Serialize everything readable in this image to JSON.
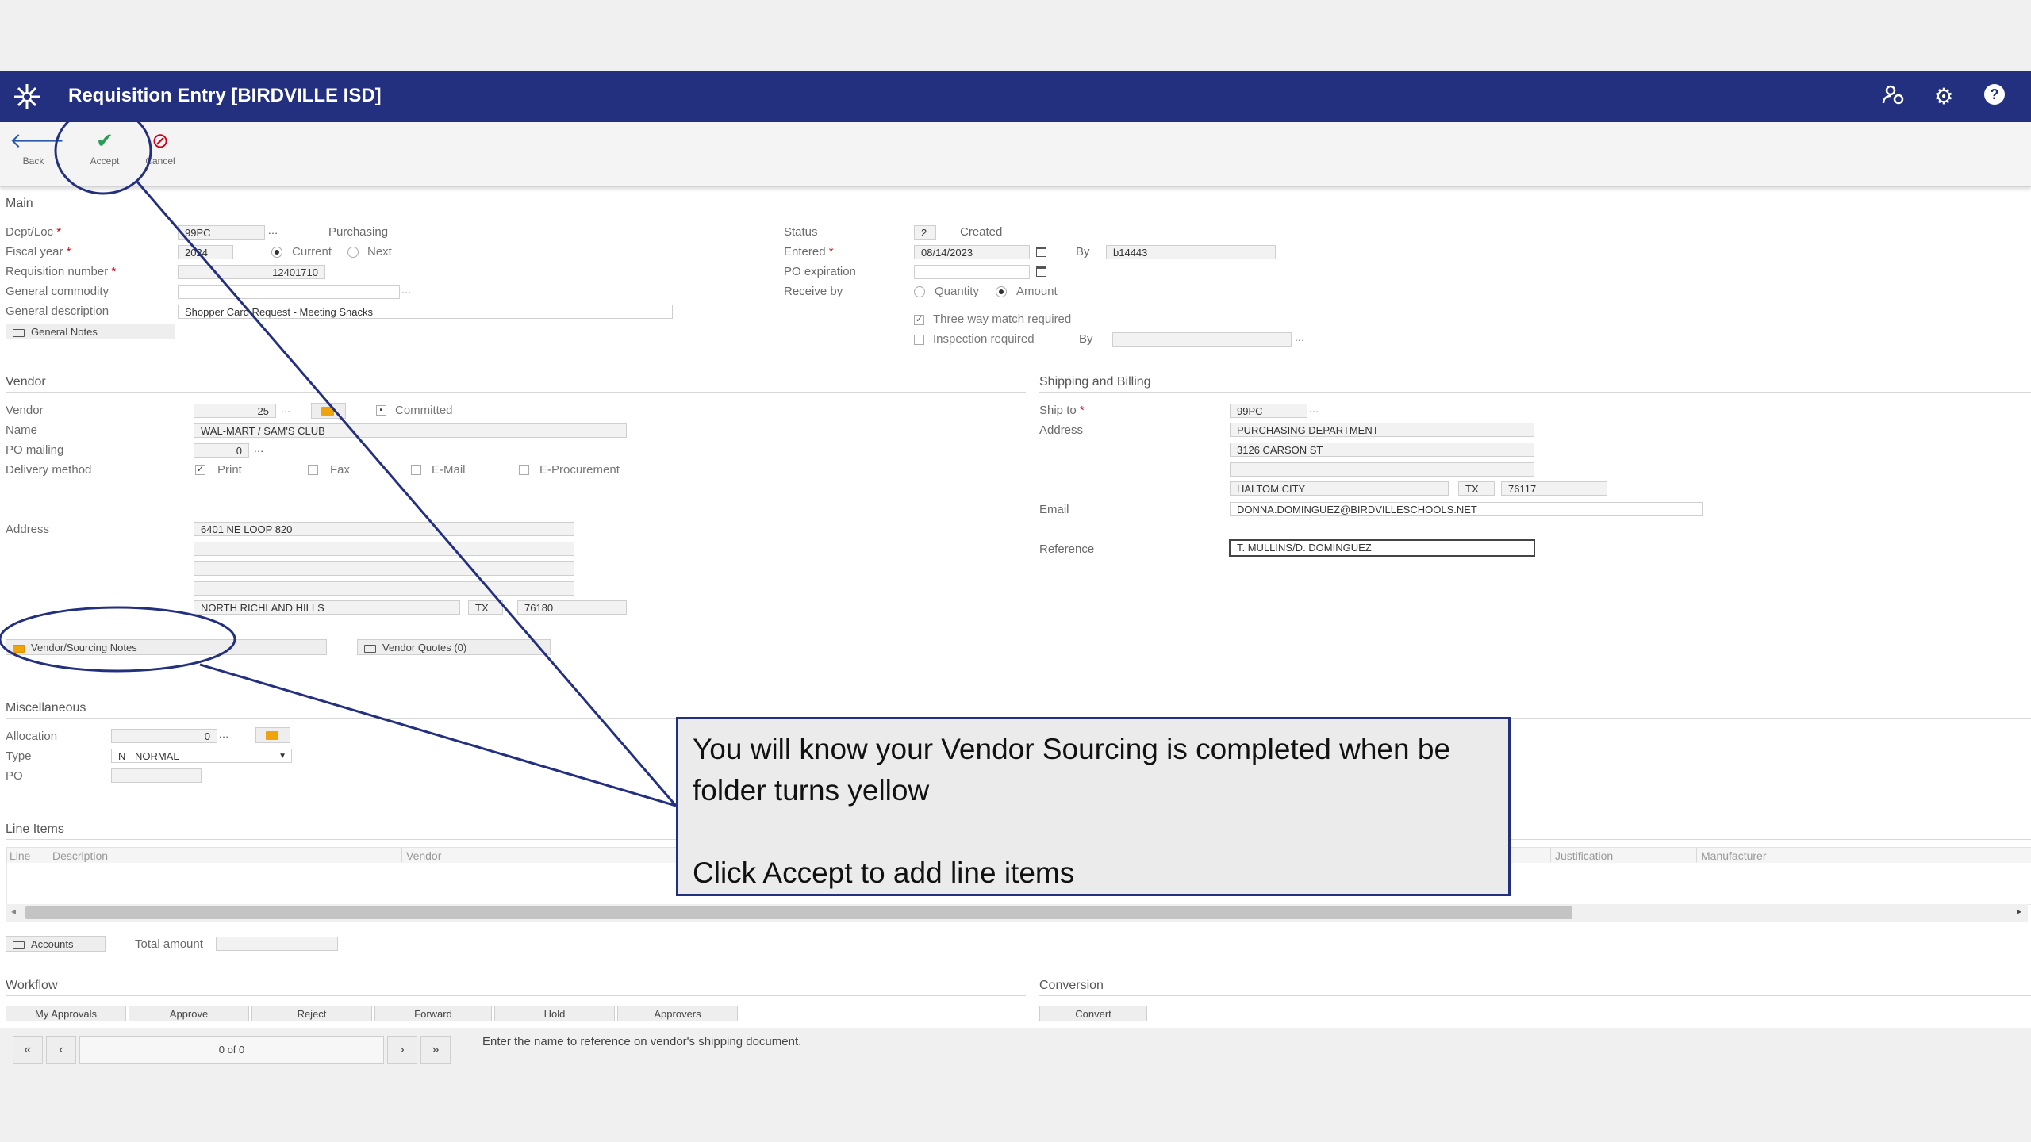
{
  "app": {
    "title": "Requisition Entry [BIRDVILLE ISD]",
    "accent": "#232f7f"
  },
  "toolbar": {
    "back_label": "Back",
    "accept_label": "Accept",
    "cancel_label": "Cancel"
  },
  "main": {
    "section": "Main",
    "dept_label": "Dept/Loc",
    "dept_value": "99PC",
    "dept_desc": "Purchasing",
    "fiscal_label": "Fiscal year",
    "fiscal_value": "2024",
    "fiscal_current": "Current",
    "fiscal_next": "Next",
    "reqnum_label": "Requisition number",
    "reqnum_value": "12401710",
    "commodity_label": "General commodity",
    "commodity_value": "",
    "desc_label": "General description",
    "desc_value": "Shopper Card Request - Meeting Snacks",
    "notes_button": "General Notes",
    "status_label": "Status",
    "status_value": "2",
    "status_text": "Created",
    "entered_label": "Entered",
    "entered_value": "08/14/2023",
    "by_label": "By",
    "by_value": "b14443",
    "expiration_label": "PO expiration",
    "receive_label": "Receive by",
    "receive_quantity": "Quantity",
    "receive_amount": "Amount",
    "threeway_label": "Three way match required",
    "inspection_label": "Inspection required",
    "inspection_by": "By"
  },
  "vendor": {
    "section": "Vendor",
    "vendor_label": "Vendor",
    "vendor_value": "25",
    "committed_label": "Committed",
    "name_label": "Name",
    "name_value": "WAL-MART / SAM'S CLUB",
    "mailing_label": "PO mailing",
    "mailing_value": "0",
    "delivery_label": "Delivery method",
    "delivery_print": "Print",
    "delivery_fax": "Fax",
    "delivery_email": "E-Mail",
    "delivery_eproc": "E-Procurement",
    "address_label": "Address",
    "address_line1": "6401 NE LOOP 820",
    "city": "NORTH RICHLAND HILLS",
    "state": "TX",
    "zip": "76180",
    "sourcing_notes": "Vendor/Sourcing Notes",
    "quotes": "Vendor Quotes (0)"
  },
  "shipping": {
    "section": "Shipping and Billing",
    "shipto_label": "Ship to",
    "shipto_value": "99PC",
    "address_label": "Address",
    "address_line1": "PURCHASING DEPARTMENT",
    "address_line2": "3126 CARSON ST",
    "city": "HALTOM CITY",
    "state": "TX",
    "zip": "76117",
    "email_label": "Email",
    "email_value": "DONNA.DOMINGUEZ@BIRDVILLESCHOOLS.NET",
    "reference_label": "Reference",
    "reference_value": "T. MULLINS/D. DOMINGUEZ"
  },
  "misc": {
    "section": "Miscellaneous",
    "allocation_label": "Allocation",
    "allocation_value": "0",
    "type_label": "Type",
    "type_value": "N - NORMAL",
    "po_label": "PO"
  },
  "lineitems": {
    "section": "Line Items",
    "columns": [
      "Line",
      "Description",
      "Vendor",
      "Justification",
      "Manufacturer"
    ]
  },
  "totals": {
    "accounts_button": "Accounts",
    "total_label": "Total amount"
  },
  "workflow": {
    "section": "Workflow",
    "buttons": [
      "My Approvals",
      "Approve",
      "Reject",
      "Forward",
      "Hold",
      "Approvers"
    ],
    "conversion_section": "Conversion",
    "convert_button": "Convert"
  },
  "footer": {
    "pager": "0 of 0",
    "hint": "Enter the name to reference on vendor's shipping document."
  },
  "callout": {
    "line1": "You will know your Vendor Sourcing is completed when be folder turns yellow",
    "line2": "Click Accept to add line items"
  }
}
